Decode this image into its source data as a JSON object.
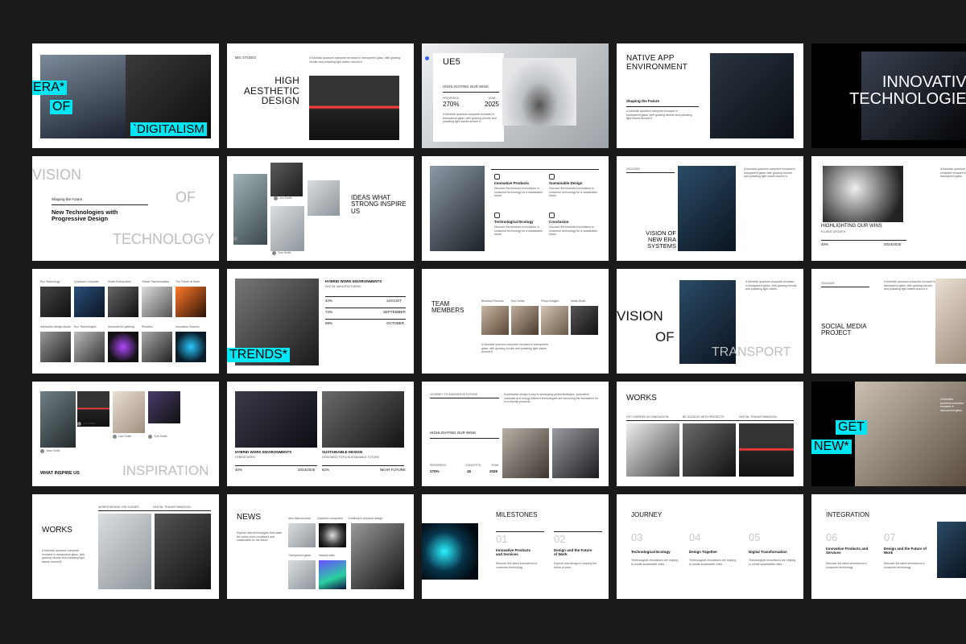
{
  "colors": {
    "accent": "#00e6f5",
    "background": "#1a1a1a",
    "slide": "#ffffff"
  },
  "s1": {
    "hl1": "ERA*",
    "hl2": "OF",
    "hl3": "`DIGITALISM"
  },
  "s2": {
    "tag": "BIG STUDIO",
    "title": "HIGH AESTHETIC DESIGN",
    "desc": "A futuristic quantum computer encased in transparent glass, with glowing circuits and pulsating light waves around it."
  },
  "s3": {
    "title": "UE5",
    "sub": "HIGHLIGHTING OUR WINS",
    "l1": "PROGRESS",
    "l2": "YEAR",
    "v1": "270%",
    "v2": "2025",
    "desc": "A futuristic quantum computer encased in transparent glass, with glowing circuits and pulsating light waves around it."
  },
  "s4": {
    "title": "NATIVE APP ENVIRONMENT",
    "sub": "Shaping the Future",
    "desc": "A futuristic quantum computer encased in transparent glass, with glowing circuits and pulsating light waves around it."
  },
  "s5": {
    "title": "INNOVATIVE TECHNOLOGIES"
  },
  "s6": {
    "w1": "VISION",
    "w2": "OF",
    "w3": "TECHNOLOGY",
    "sub": "Shaping the Future",
    "title": "New Technologies with Progressive Design"
  },
  "s7": {
    "title": "IDEAS WHAT STRONG INSPIRE US",
    "p1": "Jon Smith",
    "p2": "Liza Smith",
    "p3": "Tom Smith"
  },
  "s8": {
    "f1": "Innovative Products",
    "f2": "Sustainable Design",
    "f3": "Technological Ecology",
    "f4": "Conclusion",
    "d": "Discover the futuristic innovations in consumer technology for a sustainable future."
  },
  "s9": {
    "date": "2024/2025",
    "title": "VISION OF NEW ERA SYSTEMS",
    "desc": "A futuristic quantum computer encased in transparent glass, with glowing circuits and pulsating light waves around it."
  },
  "s10": {
    "title": "HIGHLIGHTING OUR WINS",
    "sub": "FLUENT GROWTH",
    "v1": "40%",
    "v2": "2024/2025",
    "desc": "A futuristic quantum computer encased in transparent glass."
  },
  "s11": {
    "labels": [
      "Eco Technology",
      "Quantum Computer",
      "Smart Everywhere",
      "Global Transformation",
      "The Future of Work",
      "Interactive design studio",
      "Eco Technologies",
      "Advanced AI geeking",
      "Robotics",
      "Innovation Science"
    ]
  },
  "s12": {
    "title": "HYBRID WORK ENVIRONMENTS",
    "sub": "DIGITAL MANUFACTURING",
    "r1": [
      "40%",
      "AUGUST"
    ],
    "r2": [
      "73%",
      "SEPTEMBER"
    ],
    "r3": [
      "68%",
      "OCTOBER"
    ],
    "hl": "TRENDS*"
  },
  "s13": {
    "title": "TEAM MEMBERS",
    "names": [
      "Benedict Parsons",
      "Kim Carter",
      "Freya Hodges",
      "Nolan Budd"
    ],
    "desc": "A futuristic quantum computer encased in transparent glass, with glowing circuits and pulsating light waves around it."
  },
  "s14": {
    "w1": "VISION",
    "w2": "OF",
    "w3": "TRANSPORT",
    "desc": "A futuristic quantum computer encased in transparent glass, with glowing circuits and pulsating light waves."
  },
  "s15": {
    "date": "2024/2025",
    "title": "SOCIAL MEDIA PROJECT",
    "desc": "A futuristic quantum computer encased in transparent glass, with glowing circuits and pulsating light waves around it."
  },
  "s16": {
    "title": "WHAT INSPIRE US",
    "big": "INSPIRATION",
    "p1": "Jon Smith",
    "p2": "Liza Smith",
    "p3": "Tom Smith",
    "p4": "Jane Smith"
  },
  "s17": {
    "h1": "HYBRID WORK ENVIRONMENTS",
    "s1": "HYBRID WORK",
    "h2": "SUSTAINABLE DESIGN",
    "s2": "DESIGNING FOR A SUSTAINABLE FUTURE",
    "v1": "40%",
    "v2": "2024/2025",
    "v3": "62%",
    "v4": "NEAR FUTURE"
  },
  "s18": {
    "tag": "JOURNEY TO INNOVATIVE FUTURE",
    "sub": "HIGHLIGHTING OUR WINS",
    "l1": "PROGRESS",
    "l2": "CONCEPTS",
    "l3": "YEAR",
    "v1": "270%",
    "v2": "16",
    "v3": "2025",
    "desc": "Sustainable design is key to developing global strategies. Innovative materials and energy-efficient technologies are becoming the foundation for eco-friendly products."
  },
  "s19": {
    "title": "WORKS",
    "l1": "GET INSPIRED BY INNOVATION",
    "l2": "BE GOOD BY WITH PROJECTS",
    "l3": "DIGITAL TRANSFORMATION"
  },
  "s20": {
    "hl1": "GET",
    "hl2": "NEW*",
    "desc": "A futuristic quantum computer encased in transparent glass."
  },
  "s21": {
    "title": "WORKS",
    "l1": "WORKS BEHIND THE SCENES",
    "l2": "DIGITAL TRANSFORMATION",
    "desc": "A futuristic quantum computer encased in transparent glass, with glowing circuits and pulsating light waves around it."
  },
  "s22": {
    "title": "NEWS",
    "l1": "New data sources",
    "l2": "Quantum computers",
    "l3": "Creativity in physical design",
    "l4": "Transparent glass",
    "l5": "Natural skills",
    "desc": "Explore new technologies that make the world more connected and sustainable for the future."
  },
  "s23": {
    "title": "MILESTONES",
    "n1": "01",
    "n2": "02",
    "t1": "Innovative Products and Services",
    "t2": "Design and the Future of Work",
    "d1": "Discover the latest innovations in consumer technology.",
    "d2": "Explore how design is shaping the future of work."
  },
  "s24": {
    "title": "JOURNEY",
    "n1": "03",
    "n2": "04",
    "n3": "05",
    "t1": "Technological Ecology",
    "t2": "Design Together",
    "t3": "Digital Transformation",
    "d": "Technological innovations are helping to create sustainable cities."
  },
  "s25": {
    "title": "INTEGRATION",
    "n1": "06",
    "n2": "07",
    "t1": "Innovative Products and Services",
    "t2": "Design and the Future of Work",
    "d": "Discover the latest innovations in consumer technology."
  }
}
